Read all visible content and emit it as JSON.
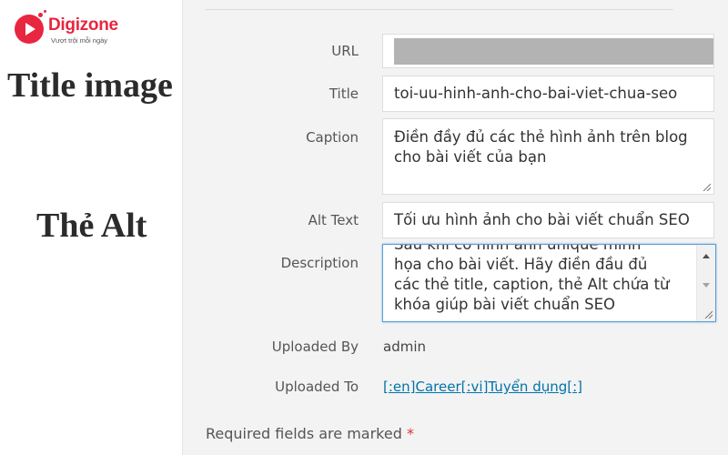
{
  "logo": {
    "name": "Digizone",
    "tagline": "Vượt trội mỗi ngày"
  },
  "annotations": {
    "title_image": "Title image",
    "alt_tag": "Thẻ Alt"
  },
  "form": {
    "url": {
      "label": "URL",
      "value": ""
    },
    "title": {
      "label": "Title",
      "value": "toi-uu-hinh-anh-cho-bai-viet-chua-seo"
    },
    "caption": {
      "label": "Caption",
      "line1": "Điền đầy đủ các thẻ hình ảnh trên blog",
      "line2": "cho bài viết của bạn"
    },
    "alt_text": {
      "label": "Alt Text",
      "value": "Tối ưu hình ảnh cho bài viết chuẩn SEO"
    },
    "description": {
      "label": "Description",
      "line0": "Sau khi có hình ảnh unique minh",
      "line1": "họa cho bài viết. Hãy điền đầu đủ",
      "line2": "các thẻ title, caption, thẻ Alt chứa từ",
      "line3": "khóa giúp bài viết chuẩn SEO"
    },
    "uploaded_by": {
      "label": "Uploaded By",
      "value": "admin"
    },
    "uploaded_to": {
      "label": "Uploaded To",
      "value": "[:en]Career[:vi]Tuyển dụng[:]"
    },
    "required_note": "Required fields are marked",
    "required_star": "*"
  },
  "colors": {
    "brand": "#e8263f",
    "arrow": "#e8161c",
    "link": "#0073aa",
    "focus": "#5b9dd9"
  }
}
